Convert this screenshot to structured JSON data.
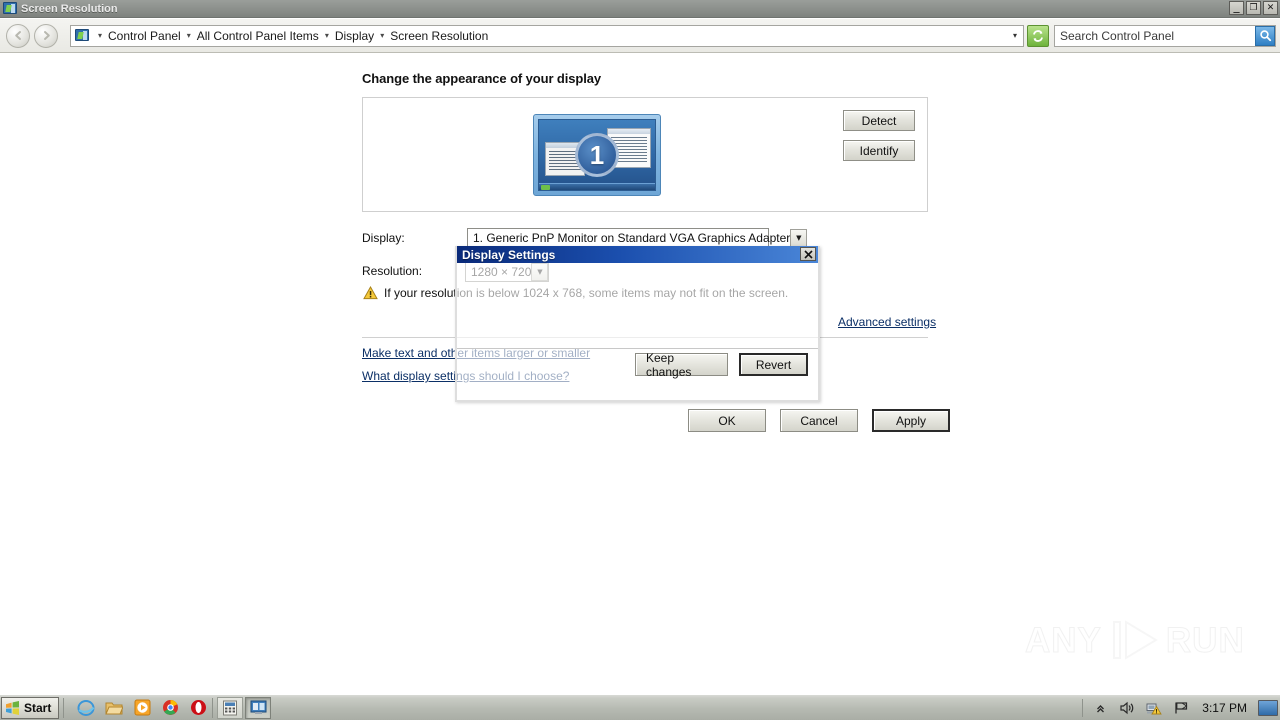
{
  "window": {
    "title": "Screen Resolution",
    "icon": "display-icon",
    "controls": [
      {
        "name": "minimize-button",
        "glyph": "_"
      },
      {
        "name": "restore-button",
        "glyph": "❐"
      },
      {
        "name": "close-button",
        "glyph": "✕"
      }
    ]
  },
  "nav": {
    "back_label": "◀",
    "forward_label": "▶",
    "breadcrumbs": [
      "Control Panel",
      "All Control Panel Items",
      "Display",
      "Screen Resolution"
    ],
    "separator": "▾",
    "dropdown_arrow": "▾",
    "refresh_label": "↻",
    "search": {
      "placeholder": "Search Control Panel",
      "value": "",
      "button_icon": "search-icon",
      "button_glyph": "⌕"
    }
  },
  "main": {
    "page_title": "Change the appearance of your display",
    "monitor_preview": {
      "number": "1",
      "alt": "monitor-1-preview"
    },
    "buttons": {
      "detect": "Detect",
      "identify": "Identify"
    },
    "fields": {
      "display_label": "Display:",
      "display_value": "1. Generic PnP Monitor on Standard VGA Graphics Adapter",
      "resolution_label": "Resolution:",
      "resolution_value": "1280 × 720",
      "combo_arrow": "▼"
    },
    "warning": {
      "icon": "warning-triangle-icon",
      "text": "If your resolution is below 1024 x 768, some items may not fit on the screen."
    },
    "links": {
      "advanced_settings": "Advanced settings",
      "make_text": "Make text and other items larger or smaller",
      "what_settings": "What display settings should I choose?"
    },
    "footer_buttons": [
      {
        "name": "ok-button",
        "label": "OK",
        "default": false
      },
      {
        "name": "cancel-button",
        "label": "Cancel",
        "default": false
      },
      {
        "name": "apply-button",
        "label": "Apply",
        "default": true
      }
    ]
  },
  "dialog": {
    "title": "Display Settings",
    "close_glyph": "✕",
    "buttons": [
      {
        "name": "keep-changes-button",
        "label": "Keep changes",
        "default": false
      },
      {
        "name": "revert-button",
        "label": "Revert",
        "default": true
      }
    ]
  },
  "watermark": {
    "left_text": "ANY",
    "right_text": "RUN"
  },
  "taskbar": {
    "start_label": "Start",
    "quick_launch": [
      {
        "name": "taskbar-icon-internet-explorer",
        "label": "e"
      },
      {
        "name": "taskbar-icon-file-explorer",
        "label": ""
      },
      {
        "name": "taskbar-icon-media-player",
        "label": "▶"
      },
      {
        "name": "taskbar-icon-chrome",
        "label": ""
      },
      {
        "name": "taskbar-icon-opera",
        "label": "O"
      }
    ],
    "tasks": [
      {
        "name": "taskbar-task-calculator",
        "active": false
      },
      {
        "name": "taskbar-task-screen-resolution",
        "active": true
      }
    ],
    "tray": {
      "chevron": "«",
      "volume_icon": "volume-icon",
      "network_icon": "network-warning-icon",
      "flag_icon": "action-center-flag-icon",
      "clock": "3:17 PM",
      "show_desktop": "show-desktop-button"
    }
  },
  "colors": {
    "titlebar": "#8e928e",
    "dialog_title": "#1b4fae",
    "link": "#0b2f66",
    "accent": "#2f67a4",
    "warning": "#f2c230"
  }
}
